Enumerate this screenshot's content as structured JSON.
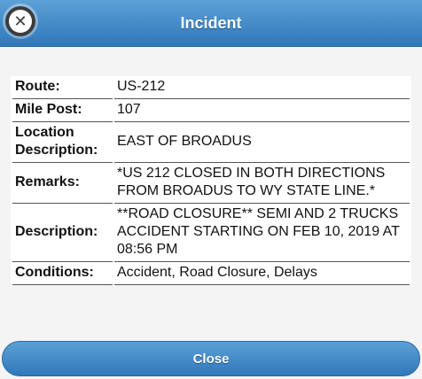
{
  "header": {
    "title": "Incident",
    "close_icon": "close-x-icon"
  },
  "details": [
    {
      "label": "Route:",
      "value": "US-212"
    },
    {
      "label": "Mile Post:",
      "value": "107"
    },
    {
      "label": "Location Description:",
      "value": "EAST OF BROADUS"
    },
    {
      "label": "Remarks:",
      "value": "*US 212 CLOSED IN BOTH DIRECTIONS FROM BROADUS TO WY STATE LINE.*"
    },
    {
      "label": "Description:",
      "value": "**ROAD CLOSURE** SEMI AND 2 TRUCKS ACCIDENT STARTING ON FEB 10, 2019 AT 08:56 PM"
    },
    {
      "label": "Conditions:",
      "value": "Accident, Road Closure, Delays"
    }
  ],
  "footer": {
    "close_label": "Close"
  },
  "colors": {
    "header_top": "#5da0d6",
    "header_bottom": "#2f78b9",
    "background": "#f4f4f4"
  }
}
